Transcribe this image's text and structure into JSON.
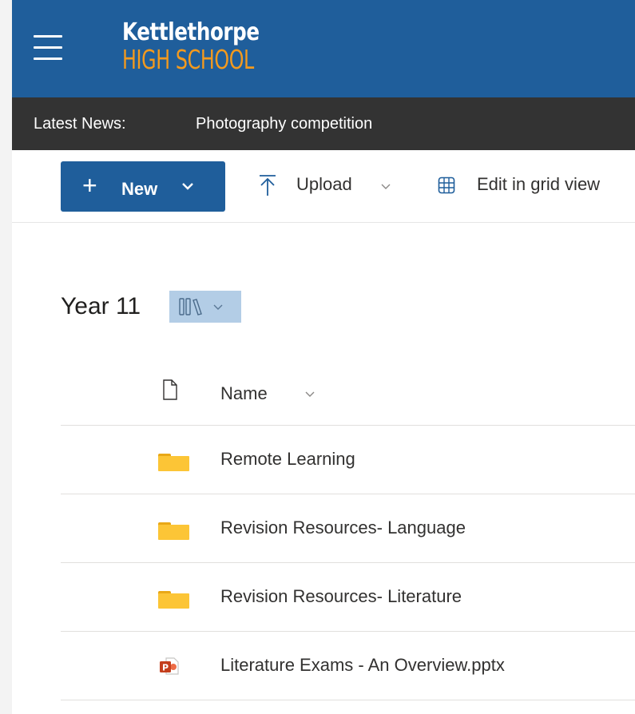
{
  "header": {
    "logo_line1": "Kettlethorpe",
    "logo_line2": "HIGH SCHOOL",
    "brand_color": "#1f5e9b",
    "accent_color": "#f39a1e"
  },
  "news": {
    "label": "Latest News:",
    "item": "Photography competition"
  },
  "toolbar": {
    "new_label": "New",
    "upload_label": "Upload",
    "grid_view_label": "Edit in grid view"
  },
  "library": {
    "title": "Year 11",
    "view_icon": "library-icon"
  },
  "list": {
    "column_name": "Name",
    "rows": [
      {
        "name": "Remote Learning",
        "icon": "folder-icon"
      },
      {
        "name": "Revision Resources- Language",
        "icon": "folder-icon"
      },
      {
        "name": "Revision Resources- Literature",
        "icon": "folder-icon"
      },
      {
        "name": "Literature Exams - An Overview.pptx",
        "icon": "powerpoint-icon"
      }
    ]
  }
}
